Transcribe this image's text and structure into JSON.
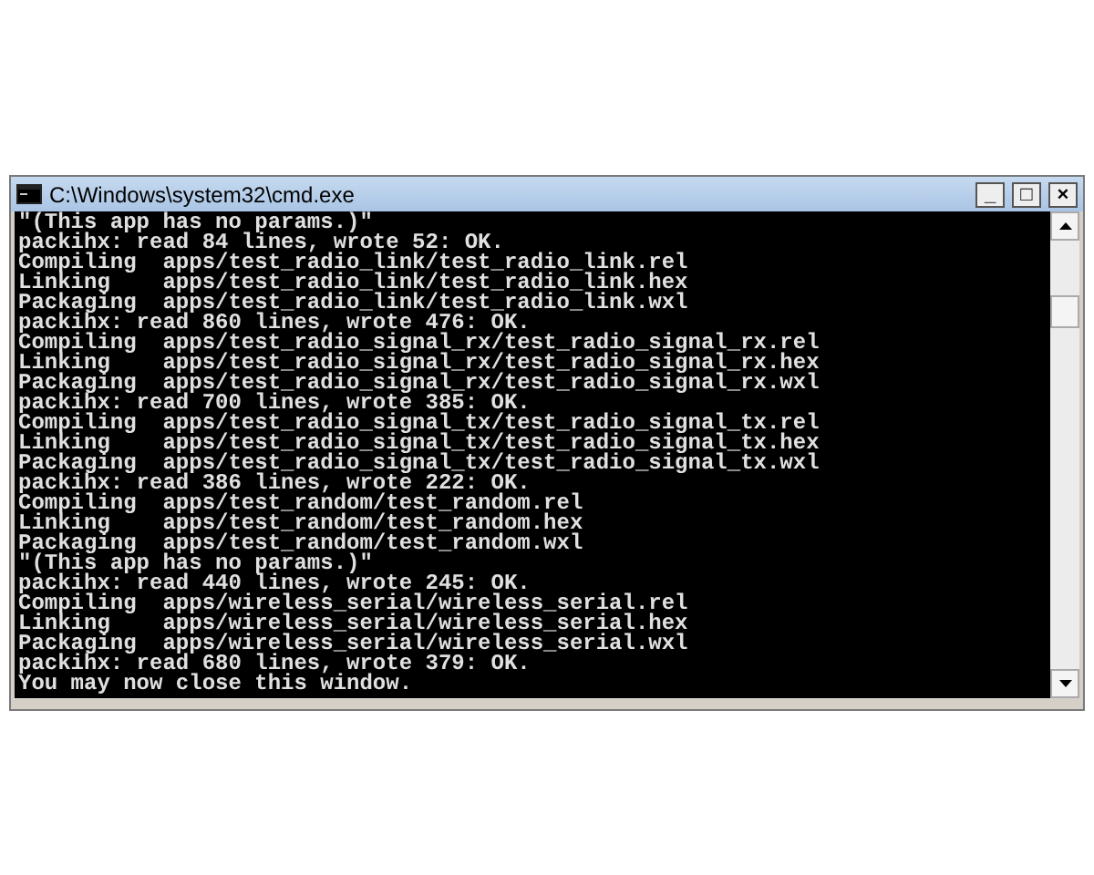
{
  "window": {
    "title": "C:\\Windows\\system32\\cmd.exe",
    "controls": [
      "_",
      "□",
      "×"
    ]
  },
  "console": {
    "lines": [
      "\"(This app has no params.)\"",
      "packihx: read 84 lines, wrote 52: OK.",
      "Compiling  apps/test_radio_link/test_radio_link.rel",
      "Linking    apps/test_radio_link/test_radio_link.hex",
      "Packaging  apps/test_radio_link/test_radio_link.wxl",
      "packihx: read 860 lines, wrote 476: OK.",
      "Compiling  apps/test_radio_signal_rx/test_radio_signal_rx.rel",
      "Linking    apps/test_radio_signal_rx/test_radio_signal_rx.hex",
      "Packaging  apps/test_radio_signal_rx/test_radio_signal_rx.wxl",
      "packihx: read 700 lines, wrote 385: OK.",
      "Compiling  apps/test_radio_signal_tx/test_radio_signal_tx.rel",
      "Linking    apps/test_radio_signal_tx/test_radio_signal_tx.hex",
      "Packaging  apps/test_radio_signal_tx/test_radio_signal_tx.wxl",
      "packihx: read 386 lines, wrote 222: OK.",
      "Compiling  apps/test_random/test_random.rel",
      "Linking    apps/test_random/test_random.hex",
      "Packaging  apps/test_random/test_random.wxl",
      "\"(This app has no params.)\"",
      "packihx: read 440 lines, wrote 245: OK.",
      "Compiling  apps/wireless_serial/wireless_serial.rel",
      "Linking    apps/wireless_serial/wireless_serial.hex",
      "Packaging  apps/wireless_serial/wireless_serial.wxl",
      "packihx: read 680 lines, wrote 379: OK.",
      "You may now close this window."
    ]
  }
}
